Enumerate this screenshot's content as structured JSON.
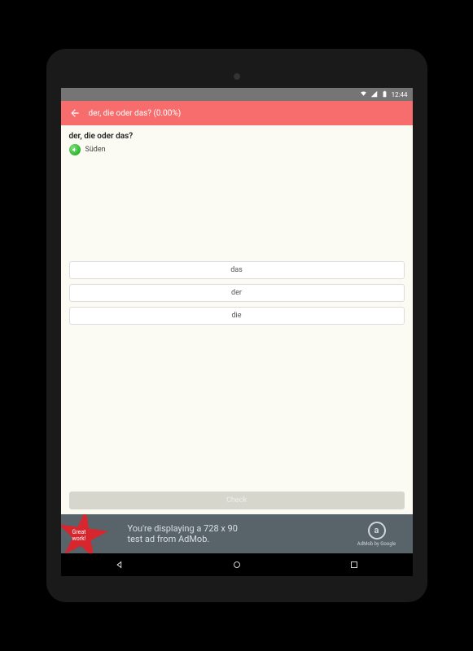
{
  "statusbar": {
    "time": "12:44"
  },
  "header": {
    "title": "der, die oder das? (0.00%)"
  },
  "question": {
    "text": "der, die oder das?",
    "word": "Süden"
  },
  "options": [
    "das",
    "der",
    "die"
  ],
  "check": {
    "label": "Check"
  },
  "ad": {
    "star_line1": "Great",
    "star_line2": "work!",
    "text_line1": "You're displaying a 728 x 90",
    "text_line2": "test ad from AdMob.",
    "brand": "AdMob by Google"
  }
}
